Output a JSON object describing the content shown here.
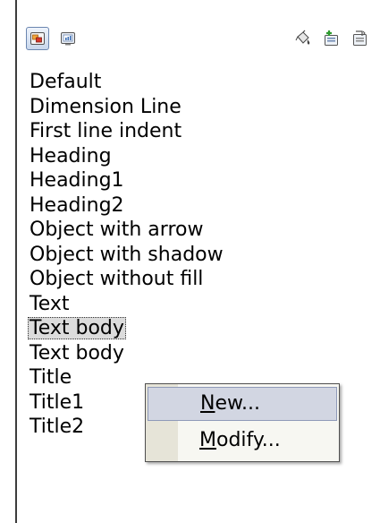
{
  "toolbar": {
    "buttons": [
      {
        "icon": "graphic-styles-icon",
        "active": true
      },
      {
        "icon": "presentation-styles-icon",
        "active": false
      },
      {
        "icon": "fill-format-mode-icon",
        "active": false
      },
      {
        "icon": "new-style-from-selection-icon",
        "active": false
      },
      {
        "icon": "update-style-icon",
        "active": false
      }
    ]
  },
  "styles": {
    "items": [
      "Default",
      "Dimension Line",
      "First line indent",
      "Heading",
      "Heading1",
      "Heading2",
      "Object with arrow",
      "Object with shadow",
      "Object without fill",
      "Text",
      "Text body",
      "Text body",
      "Title",
      "Title1",
      "Title2"
    ],
    "selected_index": 10
  },
  "context_menu": {
    "new": {
      "accel": "N",
      "rest": "ew..."
    },
    "modify": {
      "accel": "M",
      "rest": "odify..."
    }
  },
  "colors": {
    "selection_highlight": "#d2d6e2",
    "menu_background": "#f7f7f2"
  }
}
